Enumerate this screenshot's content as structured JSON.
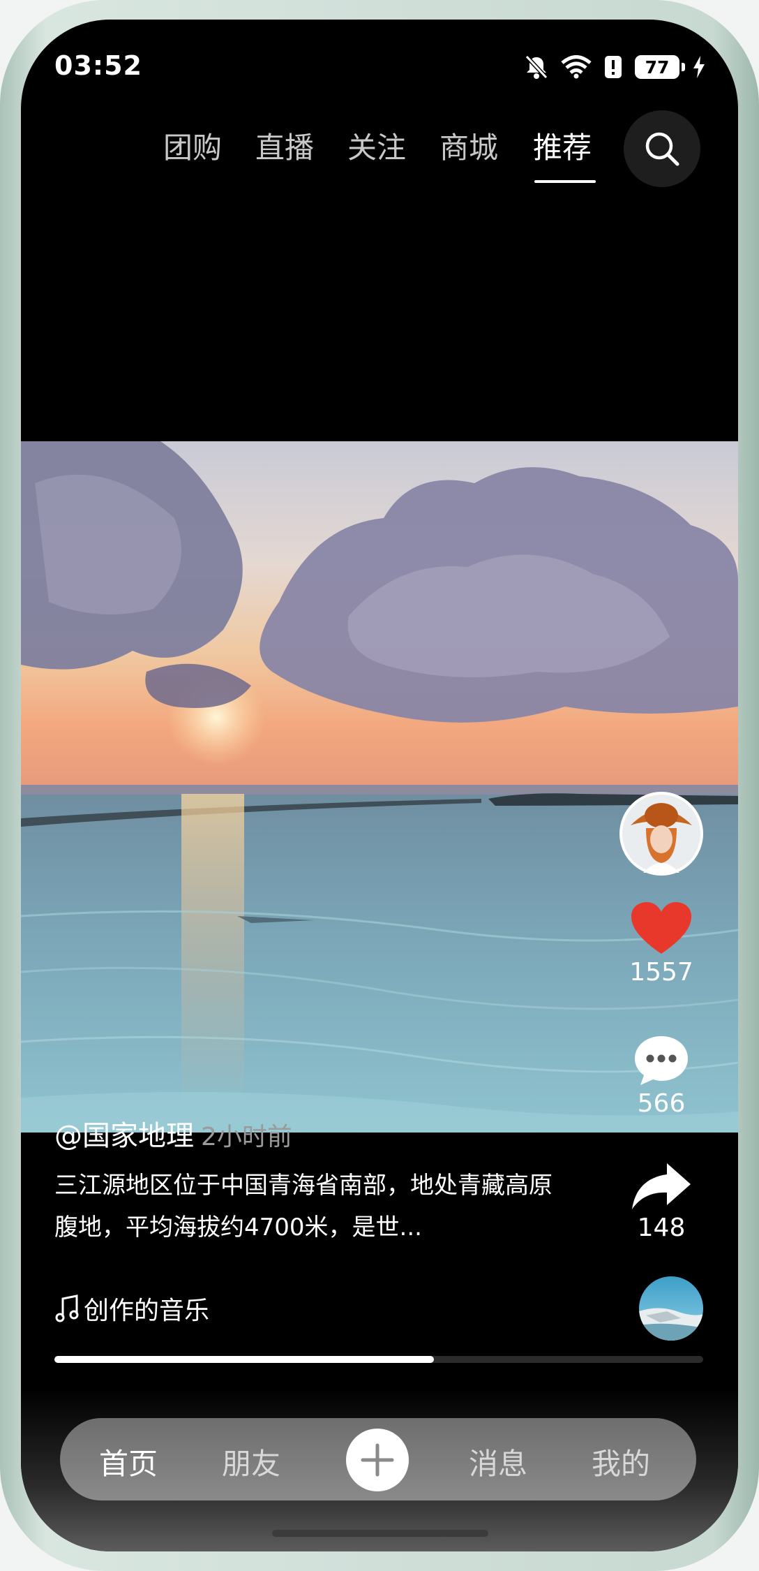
{
  "status_bar": {
    "time": "03:52",
    "battery": "77",
    "icons": [
      "bell-muted-icon",
      "wifi-icon",
      "alert-icon",
      "battery-icon",
      "charging-icon"
    ]
  },
  "top_tabs": {
    "items": [
      "团购",
      "直播",
      "关注",
      "商城",
      "推荐"
    ],
    "active": "推荐"
  },
  "video": {
    "author": "@国家地理",
    "time_ago": "2小时前",
    "description": "三江源地区位于中国青海省南部，地处青藏高原腹地，平均海拔约4700米，是世...",
    "music": "创作的音乐",
    "progress": 0.585
  },
  "actions": {
    "likes": "1557",
    "comments": "566",
    "shares": "148"
  },
  "bottom_nav": {
    "items": [
      "首页",
      "朋友",
      "消息",
      "我的"
    ],
    "active": "首页"
  },
  "colors": {
    "like": "#e8382b",
    "background": "#000000",
    "frame": "#c7d9d1"
  }
}
